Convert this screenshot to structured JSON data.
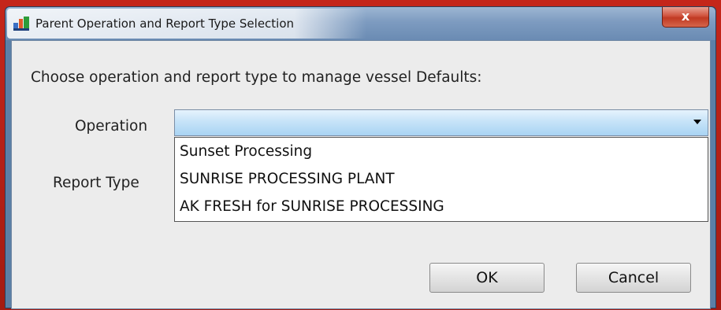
{
  "window": {
    "title": "Parent Operation and Report Type Selection",
    "close_glyph": "x"
  },
  "dialog": {
    "prompt": "Choose operation and report type to manage vessel Defaults:",
    "operation_label": "Operation",
    "operation_selected": "",
    "report_type_label": "Report Type"
  },
  "dropdown": {
    "options": [
      "Sunset Processing",
      "SUNRISE PROCESSING PLANT",
      "AK FRESH for SUNRISE PROCESSING"
    ]
  },
  "buttons": {
    "ok_label": "OK",
    "cancel_label": "Cancel"
  },
  "colors": {
    "combo_selected_fill": "#a9d4f3",
    "dialog_background": "#ececec",
    "close_button": "#c03a22"
  },
  "icons": {
    "app": "app-icon",
    "close": "close-icon",
    "dropdown_arrow": "chevron-down-icon"
  }
}
